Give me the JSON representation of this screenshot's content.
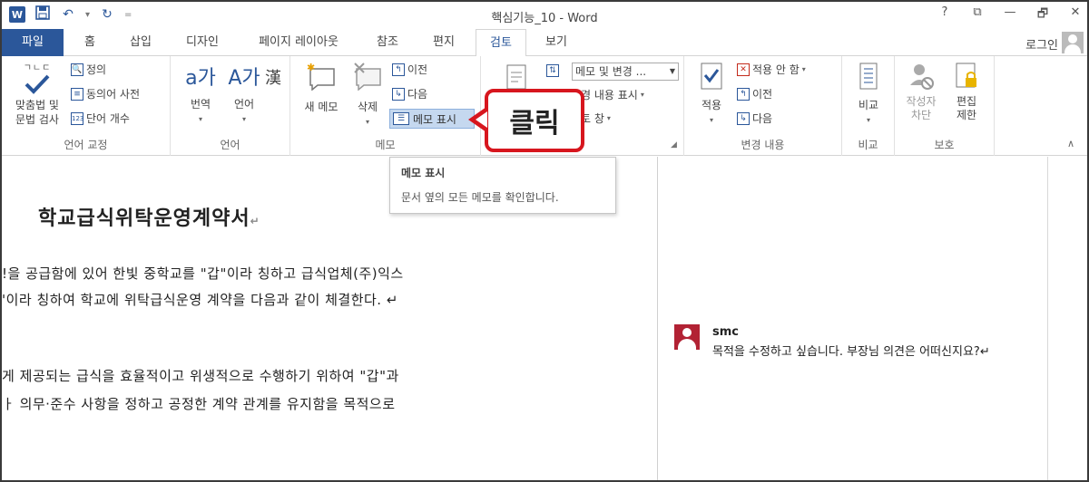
{
  "window": {
    "title": "핵심기능_10 - Word",
    "app_icon_letter": "W",
    "controls": [
      "?",
      "⧉",
      "—",
      "🗗",
      "✕"
    ]
  },
  "quick_access": {
    "save": "💾",
    "undo": "↶",
    "redo": "↻",
    "customize": "="
  },
  "tabs": {
    "file": "파일",
    "items": [
      "홈",
      "삽입",
      "디자인",
      "페이지 레이아웃",
      "참조",
      "편지",
      "검토",
      "보기"
    ],
    "active": "검토",
    "login": "로그인"
  },
  "ribbon": {
    "proofing": {
      "label": "언어 교정",
      "spell": "맞춤법 및\n문법 검사",
      "spell_icon_text": "ㄱㄴㄷ",
      "define": "정의",
      "thesaurus": "동의어 사전",
      "word_count": "단어 개수"
    },
    "language": {
      "label": "언어",
      "translate": "번역",
      "language": "언어",
      "translate_icon": "a가",
      "language_icon": "A가"
    },
    "comments": {
      "label": "메모",
      "new_comment": "새 메모",
      "delete": "삭제",
      "previous": "이전",
      "next": "다음",
      "show_comments": "메모 표시"
    },
    "tracking": {
      "display_dropdown": "메모 및 변경 ...",
      "show_markup": "경 내용 표시",
      "reviewing_pane": "토 창"
    },
    "changes": {
      "label": "변경 내용",
      "accept": "적용",
      "reject": "적용 안 함",
      "previous": "이전",
      "next": "다음"
    },
    "compare": {
      "label": "비교",
      "compare": "비교"
    },
    "protect": {
      "label": "보호",
      "block_authors": "작성자\n차단",
      "restrict_editing": "편집\n제한"
    }
  },
  "callout": {
    "text": "클릭",
    "color": "#d7161e"
  },
  "tooltip": {
    "title": "메모 표시",
    "description": "문서 옆의 모든 메모를 확인합니다."
  },
  "document": {
    "heading": "학교급식위탁운영계약서",
    "lines": [
      "!을 공급함에 있어 한빛 중학교를 \"갑\"이라 칭하고 급식업체(주)익스",
      "'이라 칭하여 학교에 위탁급식운영 계약을 다음과 같이 체결한다. ↵",
      "게 제공되는 급식을 효율적이고 위생적으로 수행하기 위하여 \"갑\"과",
      "ㅏ 의무·준수 사항을 정하고 공정한 계약 관계를 유지함을 목적으로"
    ],
    "para_mark": "↵"
  },
  "comment": {
    "author": "smc",
    "text": "목적을 수정하고 싶습니다. 부장님 의견은 어떠신지요?↵"
  },
  "colors": {
    "word_blue": "#2b579a",
    "highlight": "#c5d8ef",
    "comment_avatar": "#b22234"
  }
}
